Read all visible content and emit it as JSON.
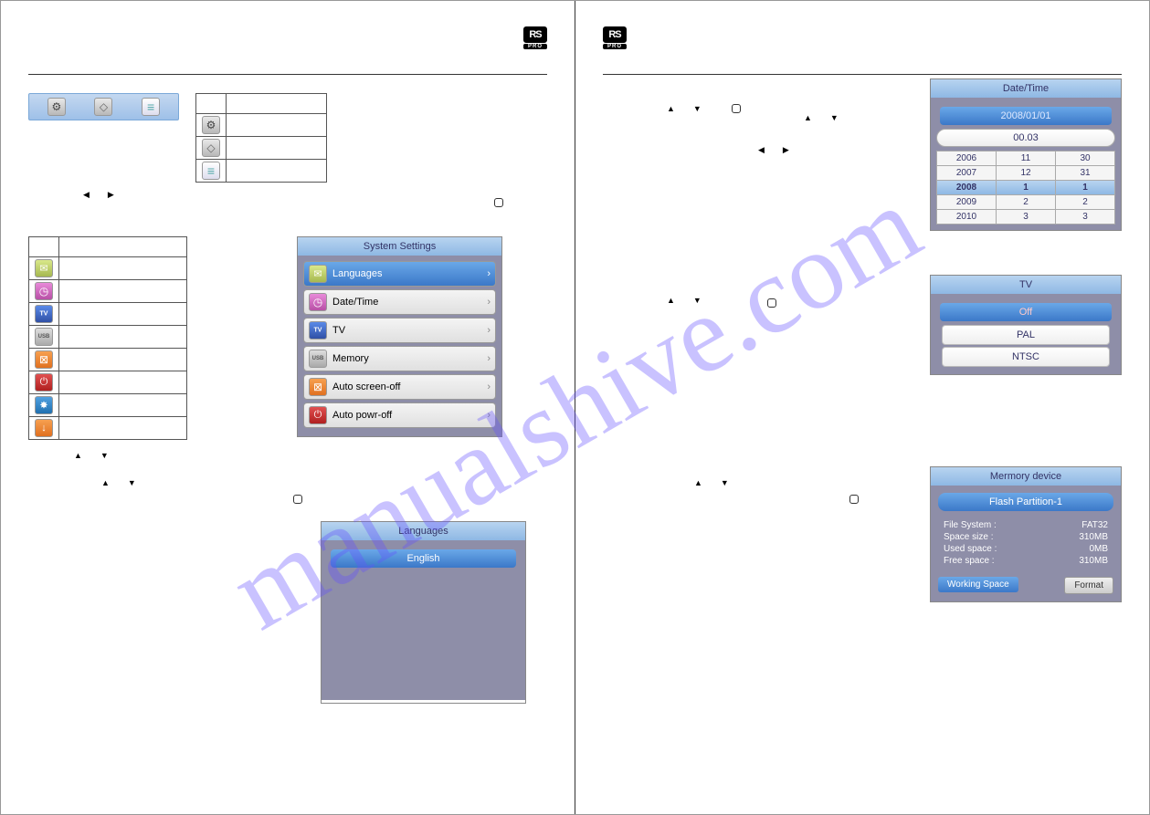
{
  "logo": {
    "top": "RS",
    "bottom": "PRO"
  },
  "left_page": {
    "main_icons": {
      "a": "gear-icon",
      "b": "book-icon",
      "c": "list-icon"
    },
    "settings_list": [
      "lang-icon",
      "date-icon",
      "tv-icon",
      "mem-icon",
      "screen-icon",
      "power-icon",
      "blue-icon",
      "orange-icon"
    ],
    "settings_panel": {
      "title": "System Settings",
      "items": [
        "Languages",
        "Date/Time",
        "TV",
        "Memory",
        "Auto screen-off",
        "Auto powr-off"
      ]
    },
    "lang_panel": {
      "title": "Languages",
      "selected": "English"
    }
  },
  "right_page": {
    "datetime": {
      "title": "Date/Time",
      "date": "2008/01/01",
      "time": "00.03",
      "grid": [
        [
          "2006",
          "11",
          "30"
        ],
        [
          "2007",
          "12",
          "31"
        ],
        [
          "2008",
          "1",
          "1"
        ],
        [
          "2009",
          "2",
          "2"
        ],
        [
          "2010",
          "3",
          "3"
        ]
      ]
    },
    "tv": {
      "title": "TV",
      "selected": "Off",
      "opt1": "PAL",
      "opt2": "NTSC"
    },
    "memory": {
      "title": "Mermory device",
      "sub": "Flash Partition-1",
      "fs_label": "File System :",
      "fs": "FAT32",
      "size_label": "Space size  :",
      "size": "310MB",
      "used_label": "Used space :",
      "used": "0MB",
      "free_label": "Free space  :",
      "free": "310MB",
      "btn1": "Working Space",
      "btn2": "Format"
    }
  },
  "watermark": "manualshive.com"
}
